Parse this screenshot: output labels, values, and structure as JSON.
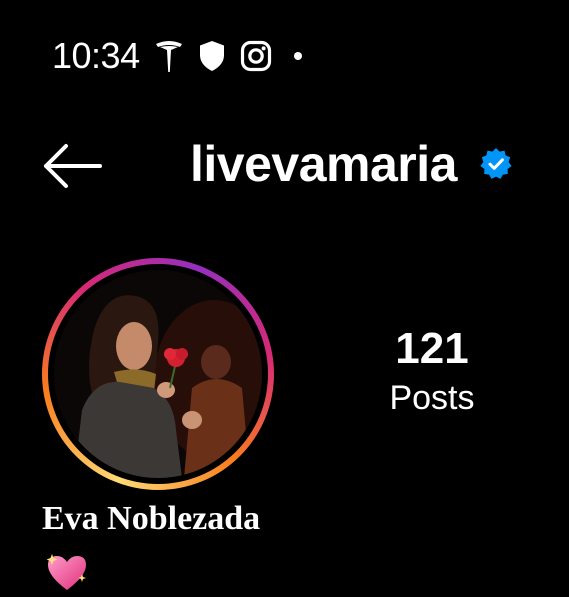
{
  "status_bar": {
    "time": "10:34",
    "icons": [
      "tesla-icon",
      "shield-icon",
      "instagram-icon",
      "notification-dot"
    ]
  },
  "header": {
    "username": "livevamaria",
    "verified": true,
    "back_icon": "arrow-left-icon"
  },
  "profile": {
    "display_name": "Eva Noblezada",
    "bio_emoji": "sparkling-heart-icon",
    "avatar": "profile-photo"
  },
  "stats": {
    "posts_count": "121",
    "posts_label": "Posts"
  },
  "colors": {
    "background": "#000000",
    "text": "#ffffff",
    "verified_blue": "#0095f6",
    "story_ring_gradient": [
      "#feda75",
      "#fa7e1e",
      "#d62976",
      "#962fbf"
    ],
    "heart_pink": "#ff5fa2"
  }
}
